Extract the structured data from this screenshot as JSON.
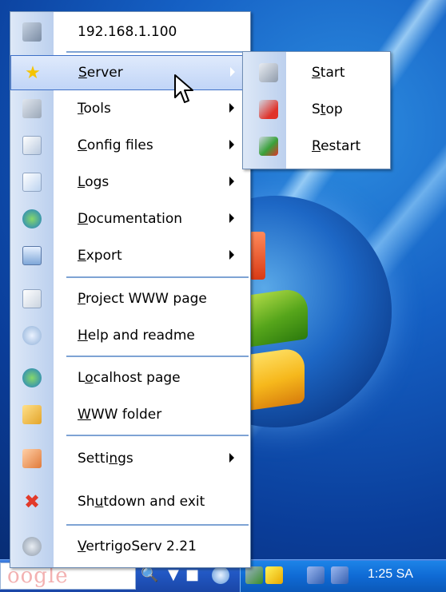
{
  "menu": {
    "items": [
      {
        "label_pre": "",
        "label_u": "",
        "label_post": "192.168.1.100",
        "icon": "network-computer-icon",
        "submenu": false
      },
      {
        "label_pre": "",
        "label_u": "S",
        "label_post": "erver",
        "icon": "star-icon",
        "submenu": true,
        "selected": true
      },
      {
        "label_pre": "",
        "label_u": "T",
        "label_post": "ools",
        "icon": "wrench-icon",
        "submenu": true
      },
      {
        "label_pre": "",
        "label_u": "C",
        "label_post": "onfig files",
        "icon": "edit-file-icon",
        "submenu": true
      },
      {
        "label_pre": "",
        "label_u": "L",
        "label_post": "ogs",
        "icon": "document-icon",
        "submenu": true
      },
      {
        "label_pre": "",
        "label_u": "D",
        "label_post": "ocumentation",
        "icon": "globe-icon",
        "submenu": true
      },
      {
        "label_pre": "",
        "label_u": "E",
        "label_post": "xport",
        "icon": "save-disk-icon",
        "submenu": true
      },
      {
        "label_pre": "",
        "label_u": "P",
        "label_post": "roject WWW page",
        "icon": "home-page-icon",
        "submenu": false
      },
      {
        "label_pre": "",
        "label_u": "H",
        "label_post": "elp and readme",
        "icon": "help-icon",
        "submenu": false
      },
      {
        "label_pre": "L",
        "label_u": "o",
        "label_post": "calhost page",
        "icon": "globe-page-icon",
        "submenu": false
      },
      {
        "label_pre": "",
        "label_u": "W",
        "label_post": "WW folder",
        "icon": "folder-icon",
        "submenu": false
      },
      {
        "label_pre": "Setti",
        "label_u": "n",
        "label_post": "gs",
        "icon": "settings-wrench-icon",
        "submenu": true
      },
      {
        "label_pre": "Sh",
        "label_u": "u",
        "label_post": "tdown and exit",
        "icon": "close-x-icon",
        "submenu": false
      },
      {
        "label_pre": "",
        "label_u": "V",
        "label_post": "ertrigoServ 2.21",
        "icon": "vertrigo-logo-icon",
        "submenu": false
      }
    ]
  },
  "server_submenu": {
    "items": [
      {
        "label_pre": "",
        "label_u": "S",
        "label_post": "tart",
        "icon": "server-start-icon"
      },
      {
        "label_pre": "S",
        "label_u": "t",
        "label_post": "op",
        "icon": "server-stop-icon"
      },
      {
        "label_pre": "",
        "label_u": "R",
        "label_post": "estart",
        "icon": "server-restart-icon"
      }
    ]
  },
  "taskbar": {
    "search_text": "oogle",
    "clock": "1:25 SA"
  },
  "colors": {
    "menu_border": "#6f8db4",
    "selection": "#c1d5f7",
    "separator": "#7ea3d4",
    "taskbar": "#2258c4"
  }
}
